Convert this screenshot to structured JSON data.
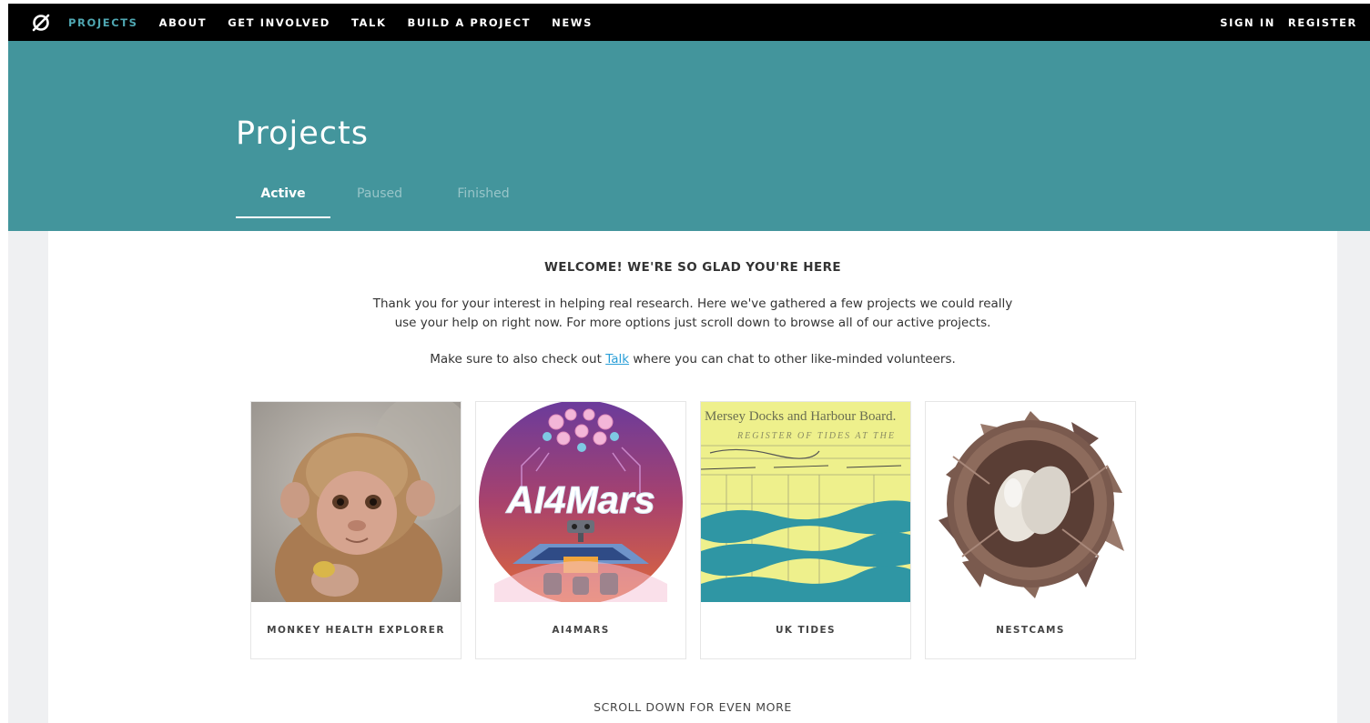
{
  "nav": {
    "logo_icon": "zooniverse-logo-icon",
    "links": [
      {
        "label": "PROJECTS",
        "active": true
      },
      {
        "label": "ABOUT"
      },
      {
        "label": "GET INVOLVED"
      },
      {
        "label": "TALK"
      },
      {
        "label": "BUILD A PROJECT"
      },
      {
        "label": "NEWS"
      }
    ],
    "sign_in": "SIGN IN",
    "register": "REGISTER"
  },
  "hero": {
    "title": "Projects",
    "tabs": [
      {
        "label": "Active",
        "active": true
      },
      {
        "label": "Paused"
      },
      {
        "label": "Finished"
      }
    ]
  },
  "main": {
    "heading": "WELCOME! WE'RE SO GLAD YOU'RE HERE",
    "intro": "Thank you for your interest in helping real research. Here we've gathered a few projects we could really use your help on right now. For more options just scroll down to browse all of our active projects.",
    "talk_prefix": "Make sure to also check out ",
    "talk_link": "Talk",
    "talk_suffix": " where you can chat to other like-minded volunteers.",
    "cards": [
      {
        "title": "MONKEY HEALTH EXPLORER"
      },
      {
        "title": "AI4MARS",
        "logo_text": "AI4Mars"
      },
      {
        "title": "UK TIDES",
        "image_text_1": "Mersey Docks and Harbour Board.",
        "image_text_2": "REGISTER OF TIDES AT THE"
      },
      {
        "title": "NESTCAMS"
      }
    ],
    "scroll_more": "SCROLL DOWN FOR EVEN MORE"
  },
  "colors": {
    "nav_bg": "#000000",
    "accent": "#4fa7b2",
    "hero_bg": "#43959c",
    "link": "#2a9fd8",
    "page_bg": "#eff0f2"
  }
}
